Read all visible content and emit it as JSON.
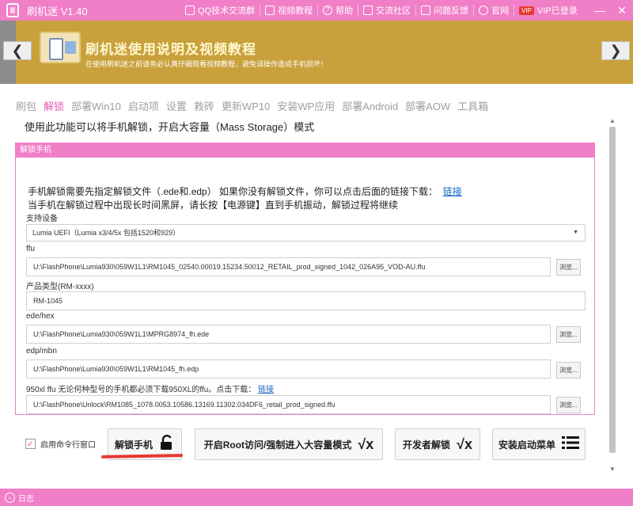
{
  "window": {
    "title": "刷机迷 V1.40",
    "links": [
      {
        "icon": "qq-icon",
        "label": "QQ技术交流群"
      },
      {
        "icon": "video-icon",
        "label": "视频教程"
      },
      {
        "icon": "help-icon",
        "label": "帮助"
      },
      {
        "icon": "community-icon",
        "label": "交流社区"
      },
      {
        "icon": "feedback-icon",
        "label": "问题反馈"
      },
      {
        "icon": "globe-icon",
        "label": "官网"
      },
      {
        "icon": "vip-icon",
        "label": "VIP已登录",
        "badge": "VIP"
      }
    ],
    "controls": {
      "minimize": "—",
      "close": "✕"
    }
  },
  "banner": {
    "title": "刷机迷使用说明及视频教程",
    "subtitle": "在使用刷机迷之前请务必认真仔细观看视频教程，避免误操作造成手机损坏！",
    "prev": "❮",
    "next": "❯"
  },
  "tabs": [
    "刷包",
    "解锁",
    "部署Win10",
    "启动项",
    "设置",
    "救砖",
    "更新WP10",
    "安装WP应用",
    "部署Android",
    "部署AOW",
    "工具箱"
  ],
  "active_tab": "解锁",
  "description": "使用此功能可以将手机解锁，开启大容量（Mass Storage）模式",
  "group": {
    "title": "解锁手机",
    "info_line1": "手机解锁需要先指定解锁文件（.ede和.edp）  如果你没有解锁文件，你可以点击后面的链接下载：",
    "info_link": "链接",
    "info_line2": "当手机在解锁过程中出现长时间黑屏，请长按【电源键】直到手机振动，解锁过程将继续",
    "device_label": "支持设备",
    "device_value": "Lumia UEFI（Lumia x3/4/5x 包括1520和929）",
    "ffu_label": "ffu",
    "ffu_value": "U:\\FlashPhone\\Lumia930\\059W1L1\\RM1045_02540.00019.15234.50012_RETAIL_prod_signed_1042_026A95_VOD-AU.ffu",
    "product_label": "产品类型(RM-xxxx)",
    "product_value": "RM-1045",
    "edehex_label": "ede/hex",
    "edehex_value": "U:\\FlashPhone\\Lumia930\\059W1L1\\MPRG8974_fh.ede",
    "edpmbn_label": "edp/mbn",
    "edpmbn_value": "U:\\FlashPhone\\Lumia930\\059W1L1\\RM1045_fh.edp",
    "ffu950_label": "950xl ffu    无论何种型号的手机都必须下载950XL的ffu。点击下载：",
    "ffu950_link": "链接",
    "ffu950_value": "U:\\FlashPhone\\Unlock\\RM1085_1078.0053.10586.13169.11302.034DF6_retail_prod_signed.ffu",
    "browse": "浏览..."
  },
  "bottom": {
    "checkbox_label": "启用命令行窗口",
    "checkbox_checked": true,
    "buttons": [
      {
        "label": "解锁手机",
        "icon": "unlock-icon"
      },
      {
        "label": "开启Root访问/强制进入大容量模式",
        "icon": "sqrt-x-icon"
      },
      {
        "label": "开发者解锁",
        "icon": "sqrt-x-icon"
      },
      {
        "label": "安装启动菜单",
        "icon": "list-icon"
      }
    ]
  },
  "status": {
    "label": "日志"
  },
  "colors": {
    "accent": "#f07fc8",
    "banner": "#c9a13c",
    "active_tab": "#e05ab3",
    "link": "#1565c0",
    "underline": "#e53935"
  }
}
